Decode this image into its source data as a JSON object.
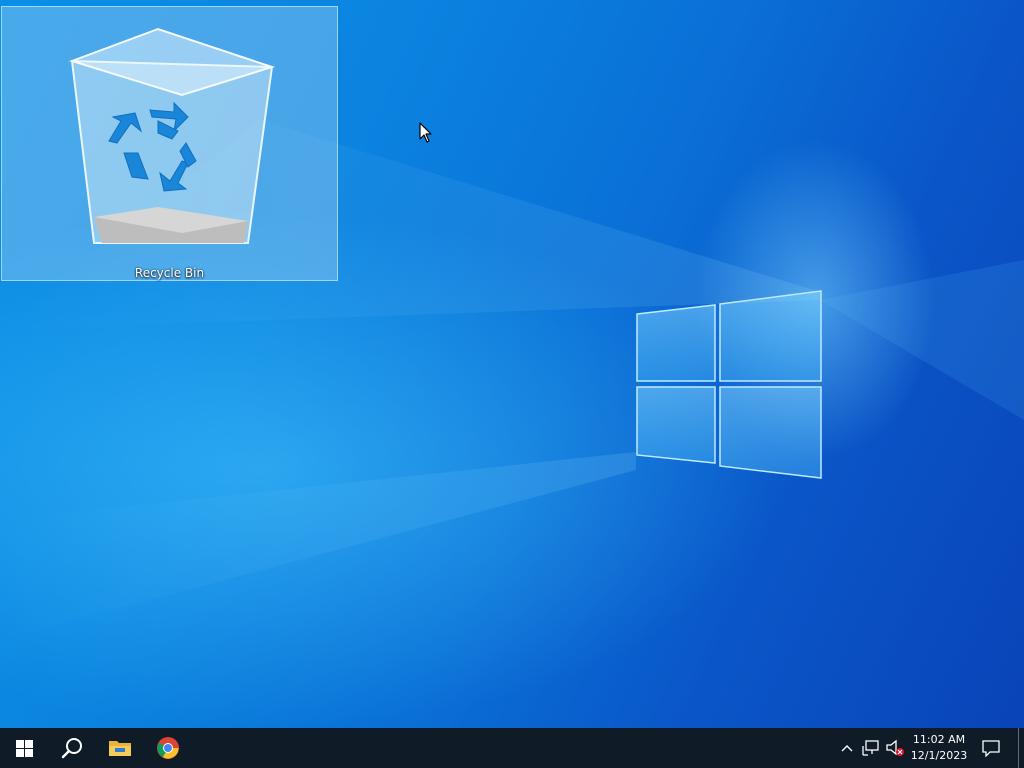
{
  "desktop": {
    "icons": [
      {
        "label": "Recycle Bin",
        "icon": "recycle-bin-icon",
        "selected": true
      }
    ],
    "wallpaper": "windows-10-hero"
  },
  "taskbar": {
    "pinned": [
      {
        "name": "start",
        "icon": "windows-logo-icon"
      },
      {
        "name": "search",
        "icon": "search-icon"
      },
      {
        "name": "file-explorer",
        "icon": "folder-icon"
      },
      {
        "name": "chrome",
        "icon": "chrome-icon"
      }
    ],
    "tray": {
      "icons": [
        "chevron-up-icon",
        "network-icon",
        "volume-muted-icon"
      ],
      "clock": {
        "time": "11:02 AM",
        "date": "12/1/2023"
      },
      "notifications_icon": "action-center-icon"
    }
  },
  "colors": {
    "taskbar": "#0f1b26",
    "desktop_accent": "#0a84e0"
  }
}
